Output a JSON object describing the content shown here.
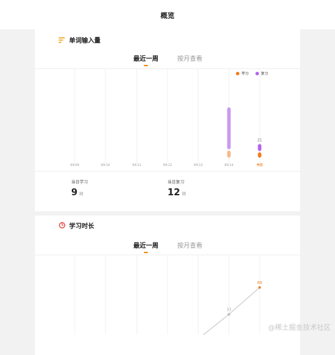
{
  "header": {
    "title": "概览"
  },
  "card1": {
    "title": "单词输入量",
    "tabs": [
      {
        "label": "最近一周"
      },
      {
        "label": "按月查看"
      }
    ],
    "legend": [
      {
        "name": "学习",
        "color": "#f07c1c"
      },
      {
        "name": "复习",
        "color": "#b562f0"
      }
    ],
    "stats": [
      {
        "label": "当日学习",
        "value": "9",
        "unit": "词"
      },
      {
        "label": "当日复习",
        "value": "12",
        "unit": "词"
      }
    ]
  },
  "card2": {
    "title": "学习时长",
    "tabs": [
      {
        "label": "最近一周"
      },
      {
        "label": "按月查看"
      }
    ]
  },
  "chart_data": [
    {
      "type": "bar",
      "stacked": true,
      "categories": [
        "09-09",
        "09-10",
        "09-11",
        "09-12",
        "09-13",
        "09-14",
        "今日"
      ],
      "series": [
        {
          "name": "学习",
          "values": [
            0,
            0,
            0,
            0,
            0,
            4,
            3
          ]
        },
        {
          "name": "复习",
          "values": [
            0,
            0,
            0,
            0,
            0,
            24,
            4
          ]
        }
      ],
      "data_labels": [
        {
          "category": "今日",
          "text": "21"
        }
      ],
      "highlight_category": "今日",
      "grid": true,
      "legend_position": "top-right",
      "colors": {
        "learn": "#f07c1c",
        "learn_faded": "#f6b98a",
        "review": "#b562f0",
        "review_faded": "#c89af0"
      }
    },
    {
      "type": "line",
      "categories": [
        "09-09",
        "09-10",
        "09-11",
        "09-12",
        "09-13",
        "09-14",
        "今日"
      ],
      "values": [
        0,
        0,
        0,
        0,
        0,
        33,
        69
      ],
      "data_labels": [
        "",
        "",
        "",
        "",
        "",
        "33",
        "69"
      ],
      "grid": true,
      "colors": {
        "line": "#cccccc",
        "last_label": "#f07c1c",
        "label": "#aaaaaa"
      }
    }
  ],
  "watermark": "@稀土掘金技术社区"
}
